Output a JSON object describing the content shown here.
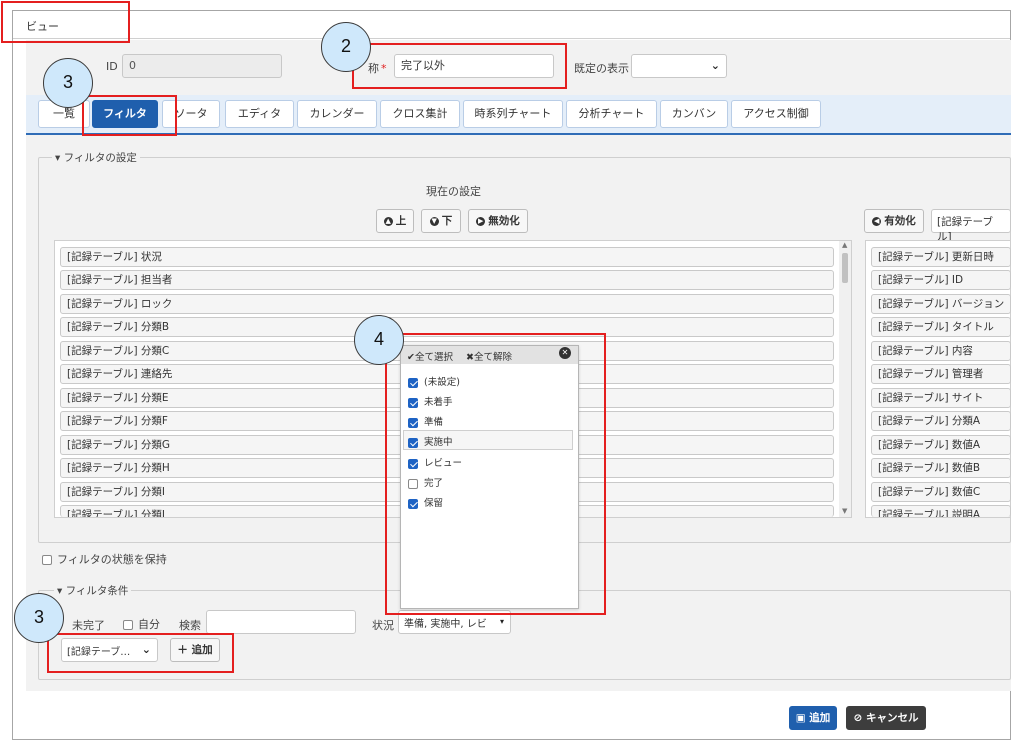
{
  "header": {
    "title": "ビュー"
  },
  "form": {
    "id_label": "ID",
    "id_value": "0",
    "name_label": "称",
    "required_mark": "*",
    "name_value": "完了以外",
    "default_display_label": "既定の表示",
    "default_display_value": ""
  },
  "tabs": [
    {
      "label": "一覧"
    },
    {
      "label": "フィルタ"
    },
    {
      "label": "ソータ"
    },
    {
      "label": "エディタ"
    },
    {
      "label": "カレンダー"
    },
    {
      "label": "クロス集計"
    },
    {
      "label": "時系列チャート"
    },
    {
      "label": "分析チャート"
    },
    {
      "label": "カンバン"
    },
    {
      "label": "アクセス制御"
    }
  ],
  "filter_settings": {
    "legend": "フィルタの設定",
    "current_label": "現在の設定",
    "btn_up": "上",
    "btn_down": "下",
    "btn_disable": "無効化",
    "btn_enable": "有効化",
    "source_select": "[記録テーブル]",
    "current_items": [
      "[記録テーブル] 状況",
      "[記録テーブル] 担当者",
      "[記録テーブル] ロック",
      "[記録テーブル] 分類B",
      "[記録テーブル] 分類C",
      "[記録テーブル] 連絡先",
      "[記録テーブル] 分類E",
      "[記録テーブル] 分類F",
      "[記録テーブル] 分類G",
      "[記録テーブル] 分類H",
      "[記録テーブル] 分類I",
      "[記録テーブル] 分類J"
    ],
    "available_items": [
      "[記録テーブル] 更新日時",
      "[記録テーブル] ID",
      "[記録テーブル] バージョン",
      "[記録テーブル] タイトル",
      "[記録テーブル] 内容",
      "[記録テーブル] 管理者",
      "[記録テーブル] サイト",
      "[記録テーブル] 分類A",
      "[記録テーブル] 数値A",
      "[記録テーブル] 数値B",
      "[記録テーブル] 数値C",
      "[記録テーブル] 説明A"
    ]
  },
  "status_popup": {
    "select_all": "全て選択",
    "deselect_all": "全て解除",
    "options": [
      {
        "label": "(未設定)",
        "checked": true
      },
      {
        "label": "未着手",
        "checked": true
      },
      {
        "label": "準備",
        "checked": true
      },
      {
        "label": "実施中",
        "checked": true
      },
      {
        "label": "レビュー",
        "checked": true
      },
      {
        "label": "完了",
        "checked": false
      },
      {
        "label": "保留",
        "checked": true
      }
    ]
  },
  "keep_filter_label": "フィルタの状態を保持",
  "filter_conditions": {
    "legend": "フィルタ条件",
    "incomplete_label": "未完了",
    "self_label": "自分",
    "search_label": "検索",
    "search_value": "",
    "status_label": "状況",
    "status_value": "準備, 実施中, レビ",
    "column_select": "[記録テーブ…",
    "add_button": "追加"
  },
  "footer": {
    "add_button": "追加",
    "cancel_button": "キャンセル"
  },
  "callouts": {
    "c1": "3",
    "c2": "2",
    "c3": "3",
    "c4": "4"
  }
}
